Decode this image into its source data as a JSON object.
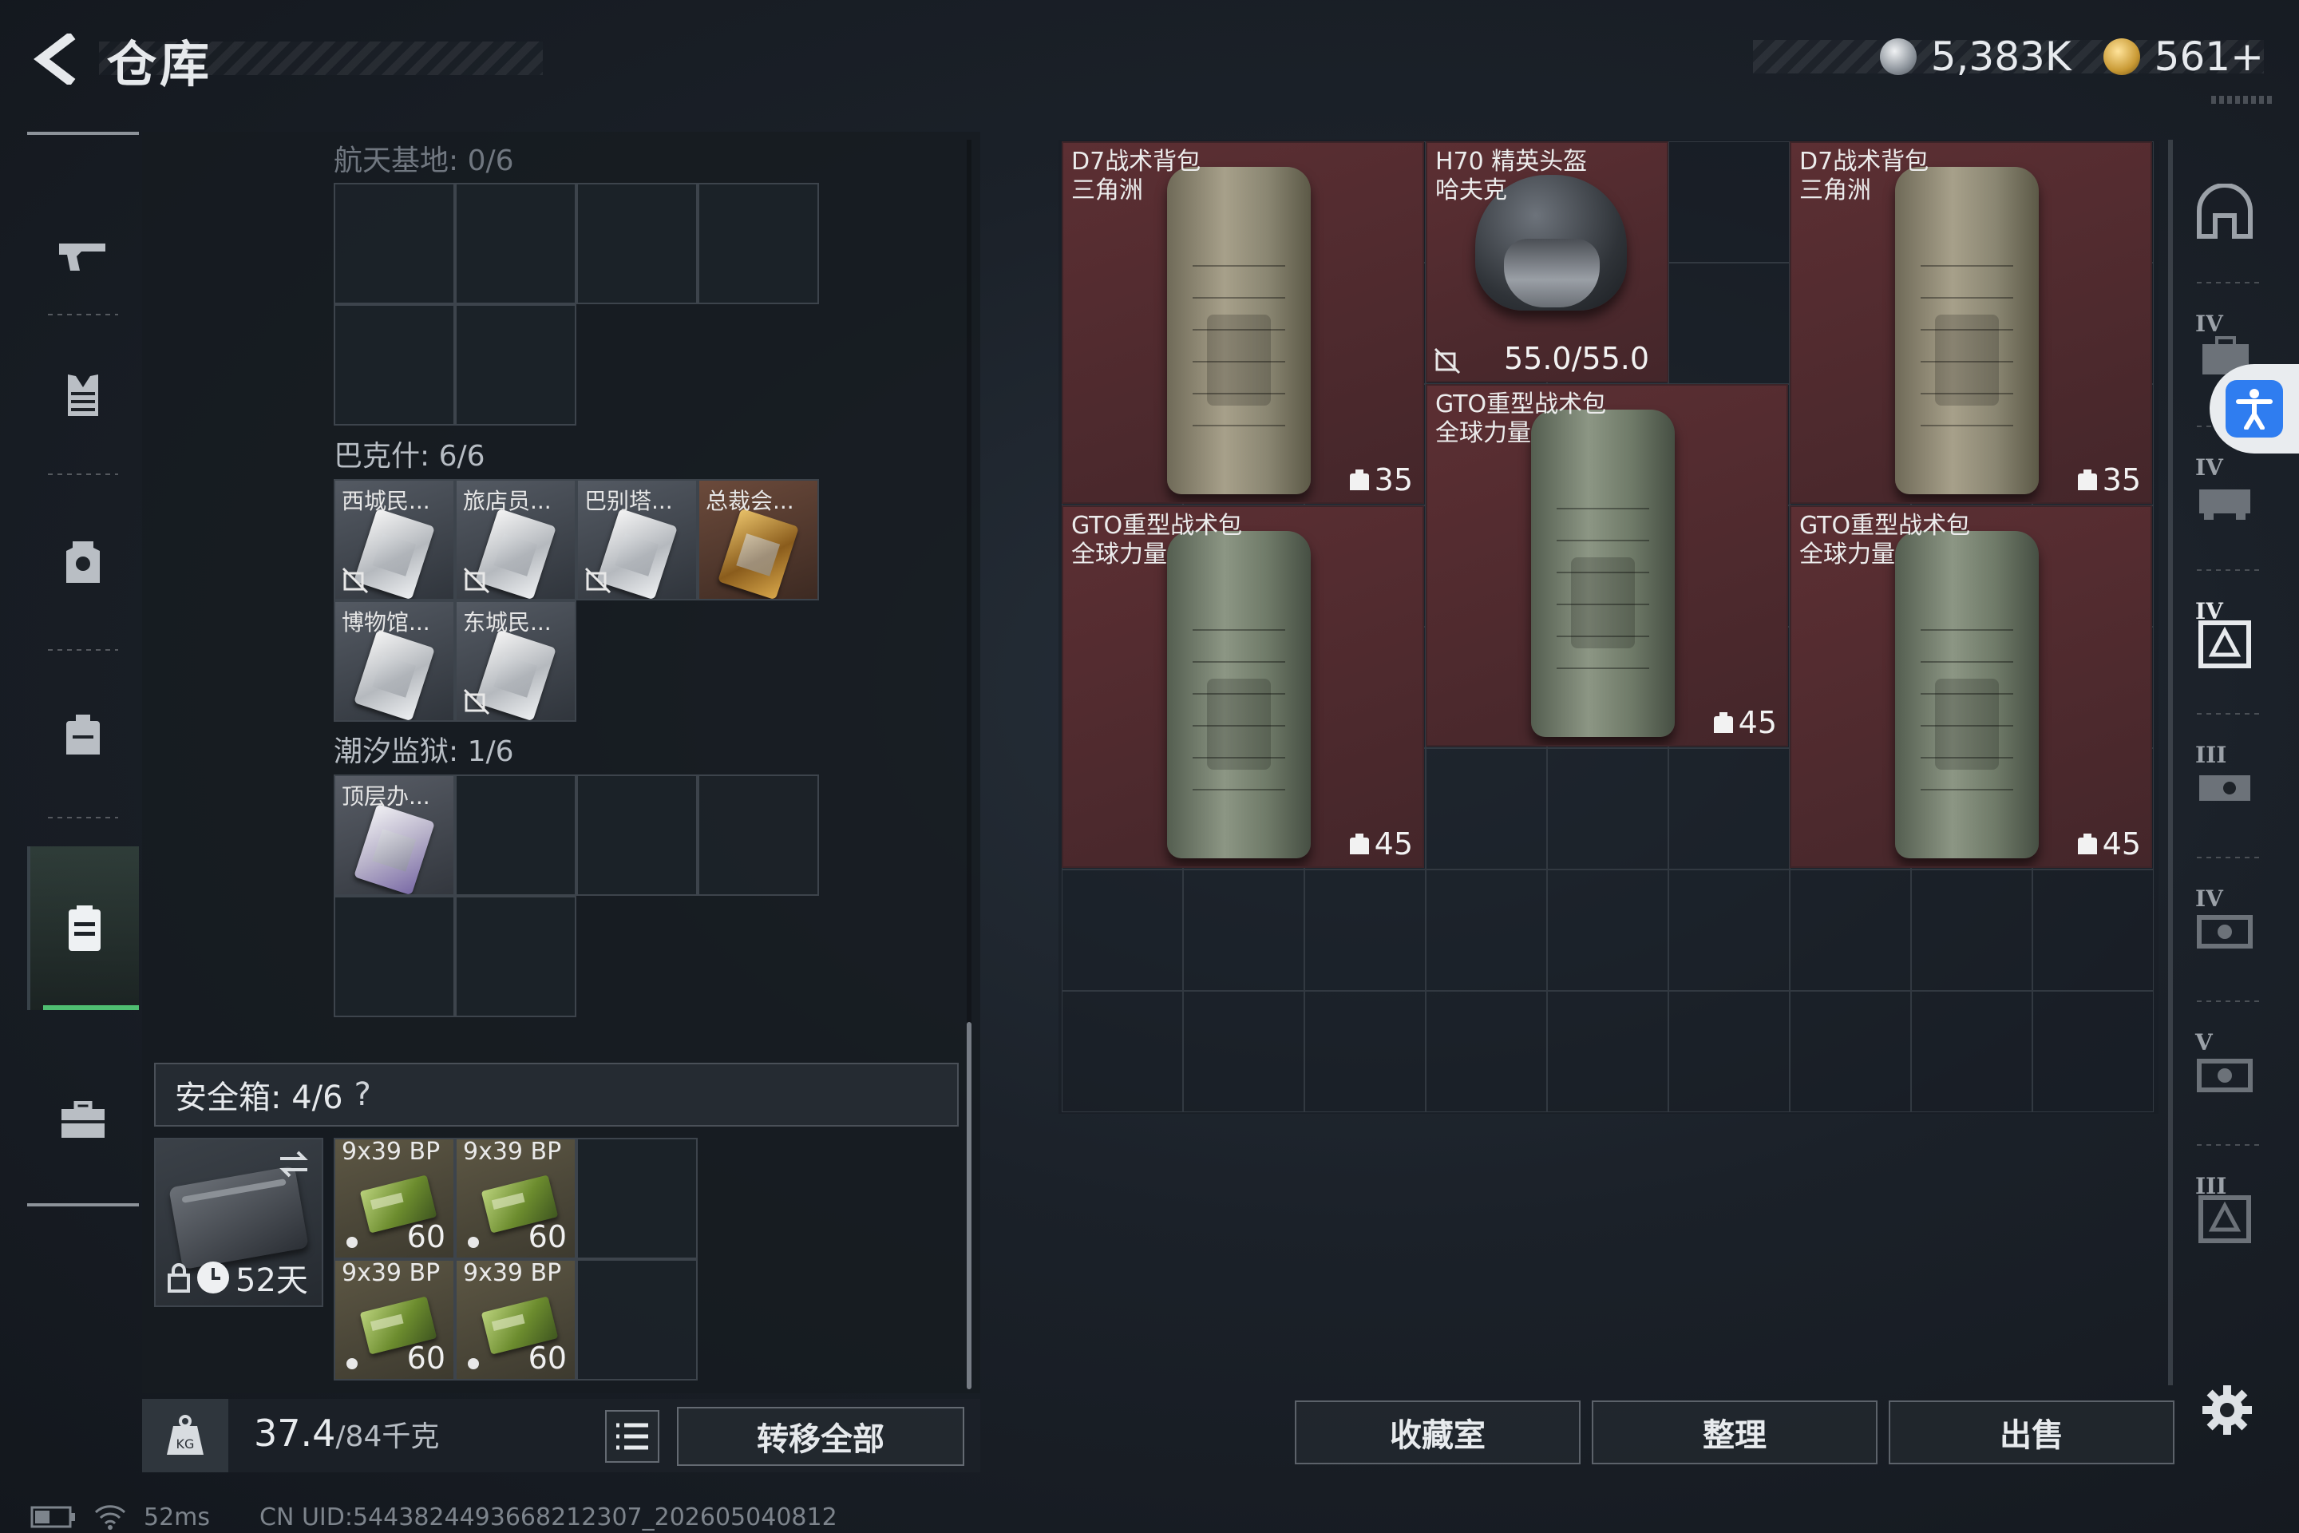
{
  "header": {
    "title": "仓库",
    "currencies": [
      {
        "icon": "silver-coin-icon",
        "value": "5,383K"
      },
      {
        "icon": "gold-coin-icon",
        "value": "561+"
      }
    ]
  },
  "sidebar": {
    "items": [
      {
        "icon": "gun-icon",
        "active": false
      },
      {
        "icon": "vest-icon",
        "active": false
      },
      {
        "icon": "armor-icon",
        "active": false
      },
      {
        "icon": "backpack-icon",
        "active": false
      },
      {
        "icon": "keycard-icon",
        "active": true
      },
      {
        "icon": "briefcase-icon",
        "active": false
      }
    ]
  },
  "stash": {
    "regions": [
      {
        "name": "航天基地: 0/6",
        "cards": []
      },
      {
        "name": "巴克什: 6/6",
        "cards": [
          {
            "label": "西城民...",
            "style": "silver",
            "nodrop": true
          },
          {
            "label": "旅店员...",
            "style": "silver",
            "nodrop": true
          },
          {
            "label": "巴别塔...",
            "style": "silver",
            "nodrop": true
          },
          {
            "label": "总裁会...",
            "style": "gold",
            "nodrop": false
          },
          {
            "label": "博物馆...",
            "style": "silver",
            "nodrop": false
          },
          {
            "label": "东城民...",
            "style": "silver",
            "nodrop": true
          }
        ]
      },
      {
        "name": "潮汐监狱: 1/6",
        "cards": [
          {
            "label": "顶层办...",
            "style": "purple",
            "nodrop": false
          }
        ]
      }
    ]
  },
  "safe_box": {
    "title": "安全箱: 4/6",
    "help": "?",
    "timer": "52天",
    "ammo": [
      {
        "label": "9x39 BP",
        "count": "60"
      },
      {
        "label": "9x39 BP",
        "count": "60"
      },
      {
        "label": "9x39 BP",
        "count": "60"
      },
      {
        "label": "9x39 BP",
        "count": "60"
      }
    ]
  },
  "weight": {
    "current": "37.4",
    "capacity": "/84千克"
  },
  "actions": {
    "transfer_all": "转移全部"
  },
  "container": {
    "items": [
      {
        "name": "D7战术背包",
        "sub": "三角洲",
        "capacity": "35",
        "kind": "tan"
      },
      {
        "name": "H70 精英头盔",
        "sub": "哈夫克",
        "durability": "55.0/55.0",
        "kind": "helmet"
      },
      {
        "name": "D7战术背包",
        "sub": "三角洲",
        "capacity": "35",
        "kind": "tan"
      },
      {
        "name": "GTO重型战术包",
        "sub": "全球力量",
        "capacity": "45",
        "kind": "olive"
      },
      {
        "name": "GTO重型战术包",
        "sub": "全球力量",
        "capacity": "45",
        "kind": "olive"
      },
      {
        "name": "GTO重型战术包",
        "sub": "全球力量",
        "capacity": "45",
        "kind": "olive"
      }
    ]
  },
  "bottom_buttons": [
    "收藏室",
    "整理",
    "出售"
  ],
  "right_nav": {
    "items": [
      {
        "tier": "",
        "icon": "dome-icon"
      },
      {
        "tier": "IV",
        "icon": "tier-4-case-icon"
      },
      {
        "tier": "IV",
        "icon": "tier-4-rig-icon"
      },
      {
        "tier": "IV",
        "icon": "tier-4-armor-icon"
      },
      {
        "tier": "III",
        "icon": "tier-3-rig-icon"
      },
      {
        "tier": "IV",
        "icon": "tier-4-box-icon"
      },
      {
        "tier": "V",
        "icon": "tier-5-box-icon"
      },
      {
        "tier": "III",
        "icon": "tier-3-armor-icon"
      }
    ]
  },
  "status": {
    "ping": "52ms",
    "uid": "CN UID:5443824493668212307_202605040812"
  },
  "colors": {
    "accent_active": "#4fbf72",
    "item_highlight": "#5c2f33",
    "accessibility_blue": "#2f7df0"
  }
}
